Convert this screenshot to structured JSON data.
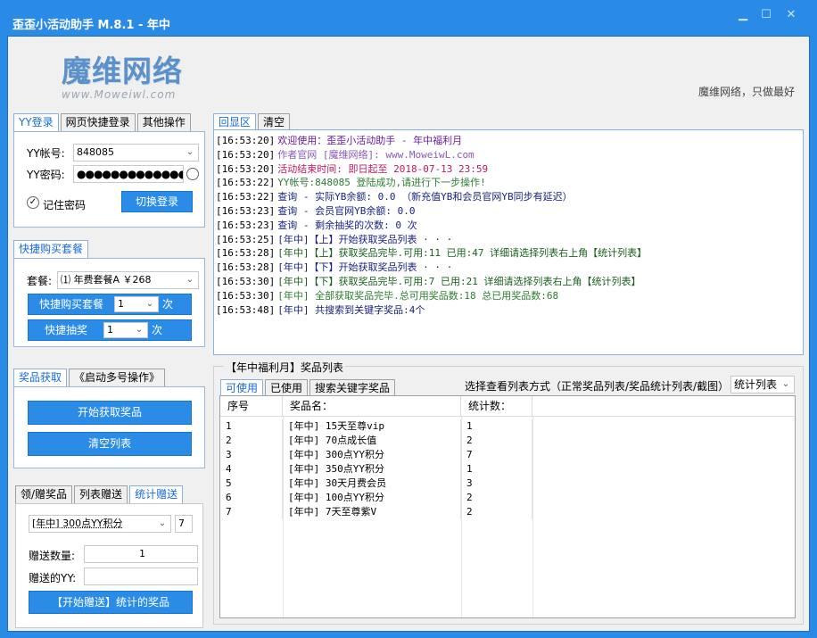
{
  "window": {
    "title": "歪歪小活动助手 M.8.1 - 年中"
  },
  "logo": {
    "main": "魔维网络",
    "sub": "www.Moweiwl.com"
  },
  "slogan": "魔维网络，只做最好",
  "login": {
    "tabs": [
      "YY登录",
      "网页快捷登录",
      "其他操作"
    ],
    "account_label": "YY帐号:",
    "account_value": "848085",
    "password_label": "YY密码:",
    "password_value": "●●●●●●●●●●●●●●",
    "remember_label": "记住密码",
    "switch_button": "切换登录"
  },
  "quick_buy": {
    "tab": "快捷购买套餐",
    "package_label": "套餐:",
    "package_value": "⑴ 年费套餐A  ￥268",
    "buy_button": "快捷购买套餐",
    "buy_count": "1",
    "buy_unit": "次",
    "lottery_button": "快捷抽奖",
    "lottery_count": "1",
    "lottery_unit": "次"
  },
  "prize": {
    "tabs": [
      "奖品获取",
      "《启动多号操作》"
    ],
    "start_button": "开始获取奖品",
    "clear_button": "清空列表"
  },
  "gift": {
    "tabs": [
      "领/赠奖品",
      "列表赠送",
      "统计赠送"
    ],
    "item_value": "[年中] 300点YY积分",
    "item_count": "7",
    "qty_label": "赠送数量:",
    "qty_value": "1",
    "target_label": "赠送的YY:",
    "target_value": "",
    "start_button": "【开始赠送】统计的奖品"
  },
  "log": {
    "tabs": [
      "回显区",
      "清空"
    ],
    "lines": [
      {
        "time": "[16:53:20]",
        "text": "欢迎使用：歪歪小活动助手 - 年中福利月",
        "color": "#6a1b9a"
      },
      {
        "time": "[16:53:20]",
        "text": "作者官网 [魔维网络]: www.MoweiwL.com",
        "color": "#8a5ab8"
      },
      {
        "time": "[16:53:20]",
        "text": "活动结束时间: 即日起至 2018-07-13 23:59",
        "color": "#c2185b"
      },
      {
        "time": "[16:53:22]",
        "text": "YY帐号:848085 登陆成功,请进行下一步操作!",
        "color": "#2e7d32"
      },
      {
        "time": "[16:53:22]",
        "text": "查询 - 实际YB余额: 0.0 （新充值YB和会员官网YB同步有延迟）",
        "color": "#1a237e"
      },
      {
        "time": "[16:53:23]",
        "text": "查询 - 会员官网YB余额: 0.0",
        "color": "#1a237e"
      },
      {
        "time": "[16:53:23]",
        "text": "查询 - 剩余抽奖的次数: 0 次",
        "color": "#1a237e"
      },
      {
        "time": "[16:53:25]",
        "text": "[年中]【上】开始获取奖品列表 · · ·",
        "color": "#1a237e"
      },
      {
        "time": "[16:53:28]",
        "text": "[年中]【上】获取奖品完毕.可用:11 已用:47 详细请选择列表右上角【统计列表】",
        "color": "#1b5e20"
      },
      {
        "time": "[16:53:28]",
        "text": "[年中]【下】开始获取奖品列表 · · ·",
        "color": "#1a237e"
      },
      {
        "time": "[16:53:30]",
        "text": "[年中]【下】获取奖品完毕.可用:7 已用:21 详细请选择列表右上角【统计列表】",
        "color": "#1b5e20"
      },
      {
        "time": "[16:53:30]",
        "text": "[年中] 全部获取奖品完毕.总可用奖品数:18 总已用奖品数:68",
        "color": "#2e7d32"
      },
      {
        "time": "[16:53:48]",
        "text": "[年中] 共搜索到关键字奖品:4个",
        "color": "#1a237e"
      }
    ]
  },
  "list": {
    "group_title": "【年中福利月】奖品列表",
    "tabs": [
      "可使用",
      "已使用",
      "搜索关键字奖品"
    ],
    "view_label": "选择查看列表方式（正常奖品列表/奖品统计列表/截图）",
    "view_value": "统计列表",
    "columns": [
      "序号",
      "奖品名：",
      "统计数："
    ],
    "rows": [
      [
        "1",
        "[年中] 15天至尊vip",
        "1"
      ],
      [
        "2",
        "[年中] 70点成长值",
        "2"
      ],
      [
        "3",
        "[年中] 300点YY积分",
        "7"
      ],
      [
        "4",
        "[年中] 350点YY积分",
        "1"
      ],
      [
        "5",
        "[年中] 30天月费会员",
        "3"
      ],
      [
        "6",
        "[年中] 100点YY积分",
        "2"
      ],
      [
        "7",
        "[年中] 7天至尊紫V",
        "2"
      ]
    ]
  }
}
